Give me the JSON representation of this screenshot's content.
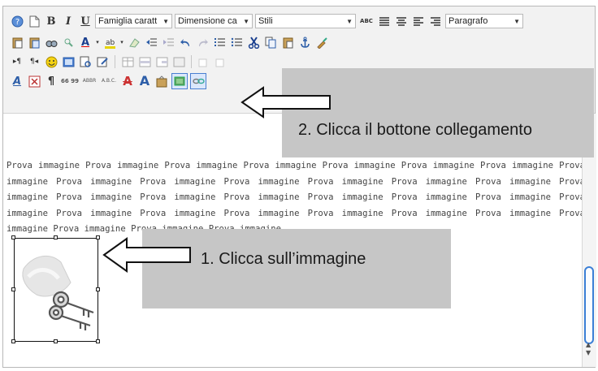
{
  "toolbar": {
    "font_family": "Famiglia caratt",
    "font_size": "Dimensione ca",
    "styles": "Stili",
    "paragraph_format": "Paragrafo",
    "abbr_label": "ABBR",
    "acronym_label": "A.B.C.",
    "cite_label": "66 99"
  },
  "editor": {
    "paragraph_text": "Prova immagine Prova immagine Prova immagine Prova immagine Prova immagine Prova immagine Prova immagine Prova immagine Prova immagine Prova immagine Prova immagine Prova immagine Prova immagine Prova immagine Prova immagine Prova immagine Prova immagine Prova immagine Prova immagine Prova immagine Prova immagine Prova immagine Prova immagine Prova immagine Prova immagine Prova immagine Prova immagine Prova immagine Prova immagine Prova immagine Prova immagine Prova immagine"
  },
  "callouts": {
    "step1": "1. Clicca sull’immagine",
    "step2": "2. Clicca il bottone collegamento"
  },
  "colors": {
    "callout_bg": "#c6c6c6",
    "scroll_thumb": "#3b7fd6",
    "toolbar_bg": "#f2f2f2"
  }
}
